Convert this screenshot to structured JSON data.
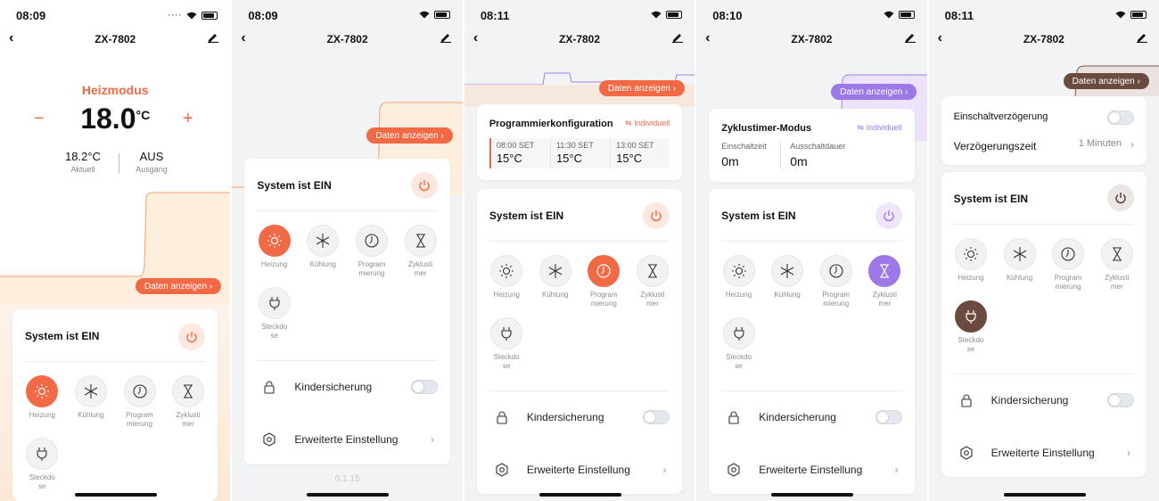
{
  "device_name": "ZX-7802",
  "panels": [
    {
      "time": "08:09"
    },
    {
      "time": "08:09"
    },
    {
      "time": "08:11"
    },
    {
      "time": "08:10"
    },
    {
      "time": "08:11"
    }
  ],
  "heat": {
    "mode": "Heizmodus",
    "setpoint": "18.0",
    "unit": "°C",
    "minus": "−",
    "plus": "+",
    "current": "18.2°C",
    "current_label": "Aktuell",
    "output": "AUS",
    "output_label": "Ausgang"
  },
  "data_btn": "Daten anzeigen",
  "system_on": "System ist EIN",
  "modes": {
    "heat": [
      "Heizung"
    ],
    "cool": [
      "Kühlung"
    ],
    "prog": [
      "Program",
      "mierung"
    ],
    "cycle": [
      "Zyklusti",
      "mer"
    ],
    "socket": [
      "Steckdo",
      "se"
    ]
  },
  "child_lock": "Kindersicherung",
  "advanced": "Erweiterte Einstellung",
  "version": "0.1.15",
  "prog": {
    "title": "Programmierkonfiguration",
    "tag": "Individuell",
    "slots": [
      {
        "time": "08:00 SET",
        "temp": "15°C"
      },
      {
        "time": "11:30 SET",
        "temp": "15°C"
      },
      {
        "time": "13:00 SET",
        "temp": "15°C"
      }
    ]
  },
  "cycle": {
    "title": "Zyklustimer-Modus",
    "tag": "Individuell",
    "on_label": "Einschaltzeit",
    "on_value": "0m",
    "off_label": "Ausschaltdauer",
    "off_value": "0m"
  },
  "delay": {
    "title": "Einschaltverzögerung",
    "time_label": "Verzögerungszeit",
    "time_value": "1 Minuten"
  },
  "colors": {
    "orange": "#f26a45",
    "purple": "#9d79e8",
    "brown": "#6b4a3f"
  }
}
